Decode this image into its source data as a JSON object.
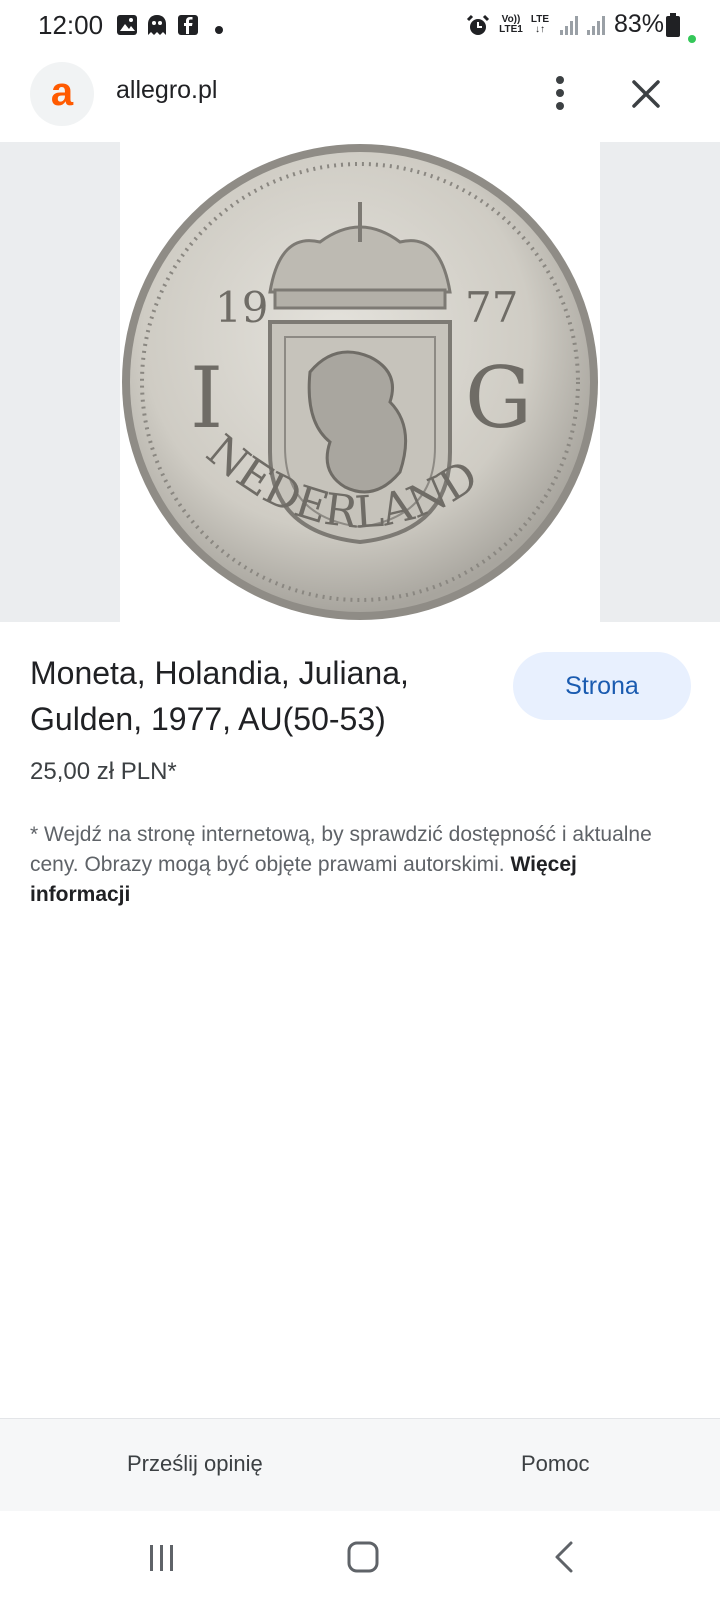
{
  "status_bar": {
    "time": "12:00",
    "volte_top": "Vo))",
    "volte_bottom": "LTE1",
    "lte_top": "LTE",
    "lte_bottom": "↓↑",
    "battery_percent": "83%",
    "icons": [
      "gallery-icon",
      "ghost-icon",
      "facebook-icon",
      "dot-icon",
      "alarm-icon",
      "signal-icon",
      "signal-icon",
      "battery-icon"
    ]
  },
  "header": {
    "logo_letter": "a",
    "domain": "allegro.pl",
    "logo_color": "#ff5a00"
  },
  "product": {
    "image_alt": "Coin 1 Gulden 1977 Nederland",
    "coin_text": {
      "year_left": "19",
      "year_right": "77",
      "left_letter": "I",
      "right_letter": "G",
      "legend": "NEDERLAND"
    },
    "title": "Moneta, Holandia, Juliana, Gulden, 1977, AU(50-53)",
    "visit_button": "Strona",
    "price": "25,00 zł PLN*",
    "disclaimer": "* Wejdź na stronę internetową, by sprawdzić dostępność i aktualne ceny. Obrazy mogą być objęte prawami autorskimi.",
    "more_info": "Więcej informacji"
  },
  "footer": {
    "feedback": "Prześlij opinię",
    "help": "Pomoc"
  },
  "nav": {
    "icons": [
      "recent-apps-icon",
      "home-icon",
      "back-icon"
    ]
  }
}
